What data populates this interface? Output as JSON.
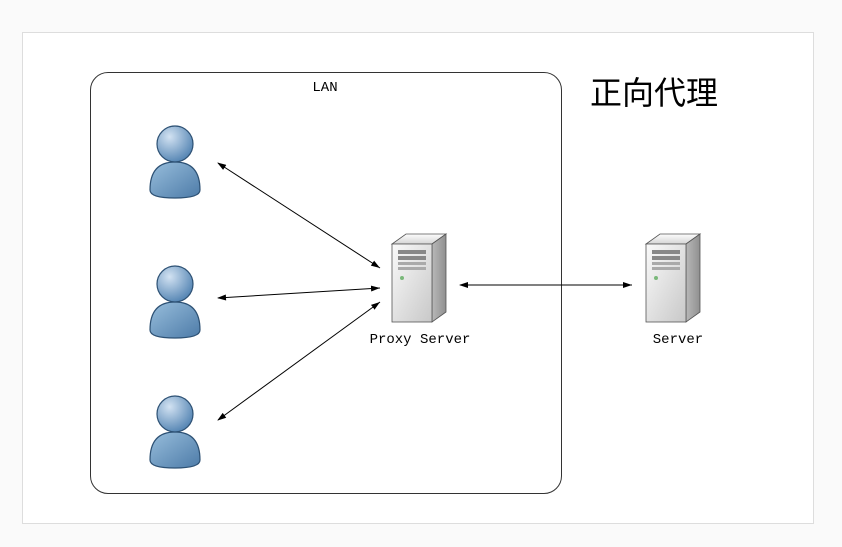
{
  "title": "正向代理",
  "lan_label": "LAN",
  "proxy_label": "Proxy Server",
  "server_label": "Server",
  "users": [
    "user1",
    "user2",
    "user3"
  ]
}
